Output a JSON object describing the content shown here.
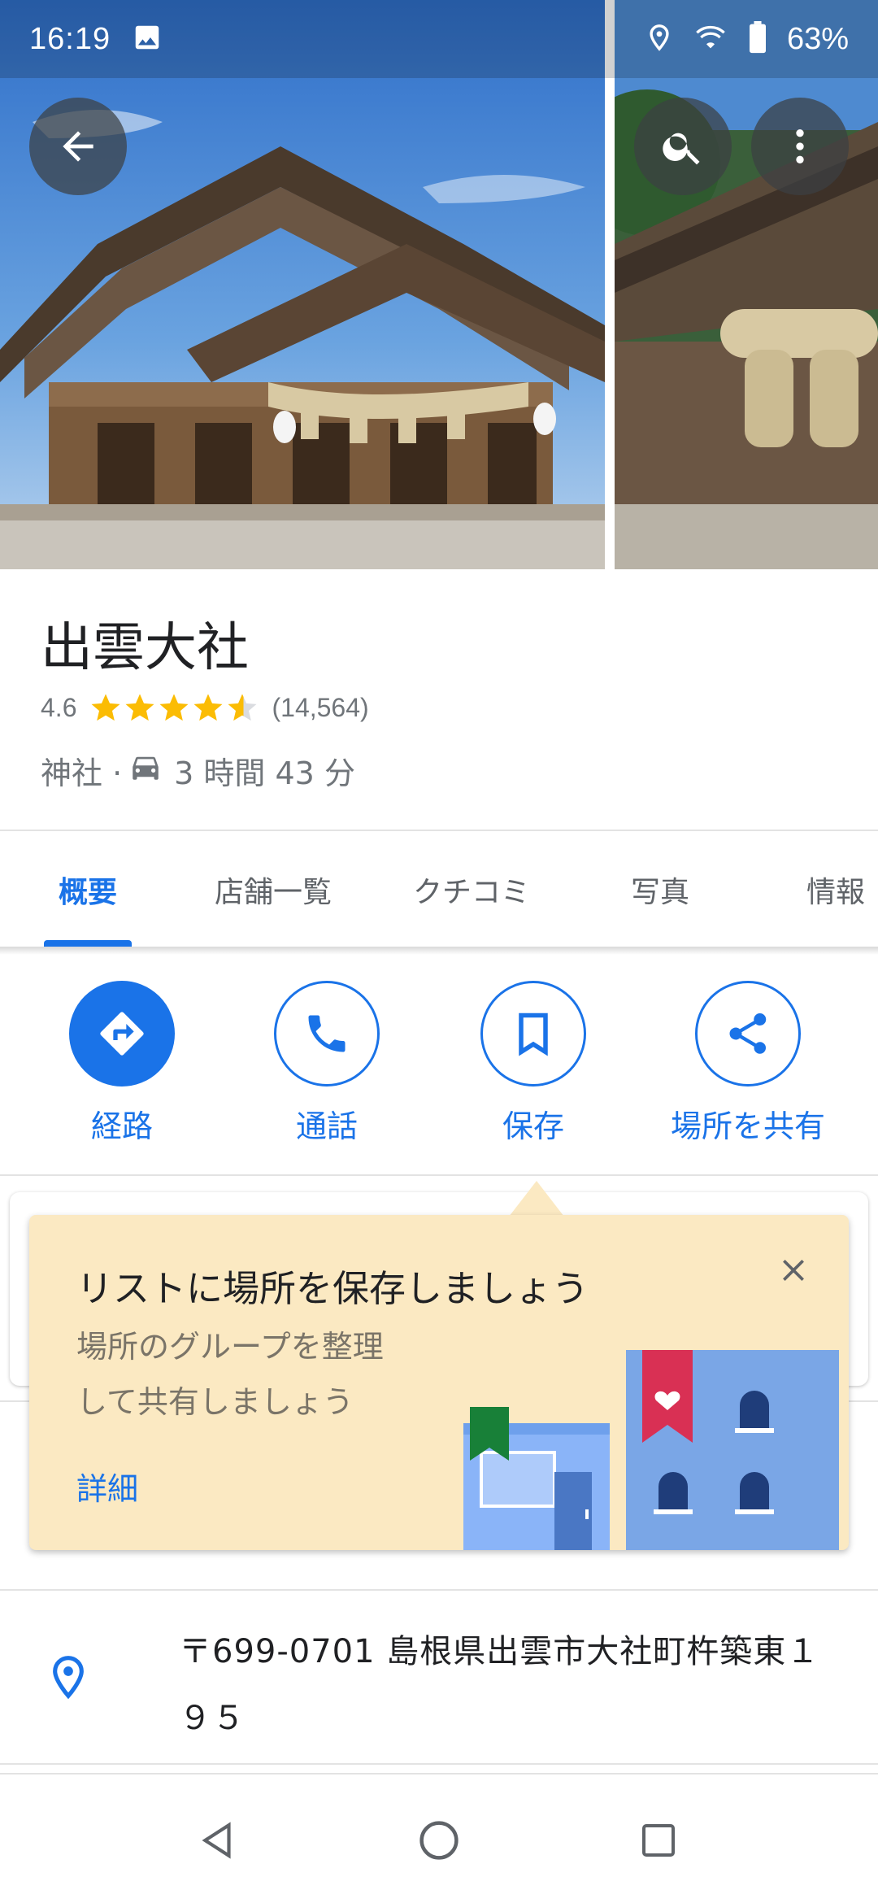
{
  "status_bar": {
    "time": "16:19",
    "battery": "63%",
    "icons": [
      "image-icon",
      "location-icon",
      "wifi-icon",
      "battery-icon"
    ]
  },
  "place": {
    "name": "出雲大社",
    "rating": "4.6",
    "stars": 4.6,
    "review_count": "(14,564)",
    "category": "神社 · ",
    "drive_time": "3 時間 43 分"
  },
  "tabs": [
    {
      "label": "概要",
      "active": true
    },
    {
      "label": "店舗一覧",
      "active": false
    },
    {
      "label": "クチコミ",
      "active": false
    },
    {
      "label": "写真",
      "active": false
    },
    {
      "label": "情報",
      "active": false
    }
  ],
  "actions": [
    {
      "label": "経路",
      "icon": "directions-icon"
    },
    {
      "label": "通話",
      "icon": "phone-icon"
    },
    {
      "label": "保存",
      "icon": "bookmark-icon"
    },
    {
      "label": "場所を共有",
      "icon": "share-icon"
    }
  ],
  "promo": {
    "title": "リストに場所を保存しましょう",
    "body_line1": "場所のグループを整理",
    "body_line2": "して共有しましょう",
    "link": "詳細"
  },
  "address": {
    "line1": "〒699-0701 島根県出雲市大社町杵築東１",
    "line2": "９５"
  },
  "colors": {
    "accent": "#1a73e8",
    "star": "#fbbc04",
    "promo_bg": "#fbe9c2",
    "muted_text": "#70757a"
  }
}
